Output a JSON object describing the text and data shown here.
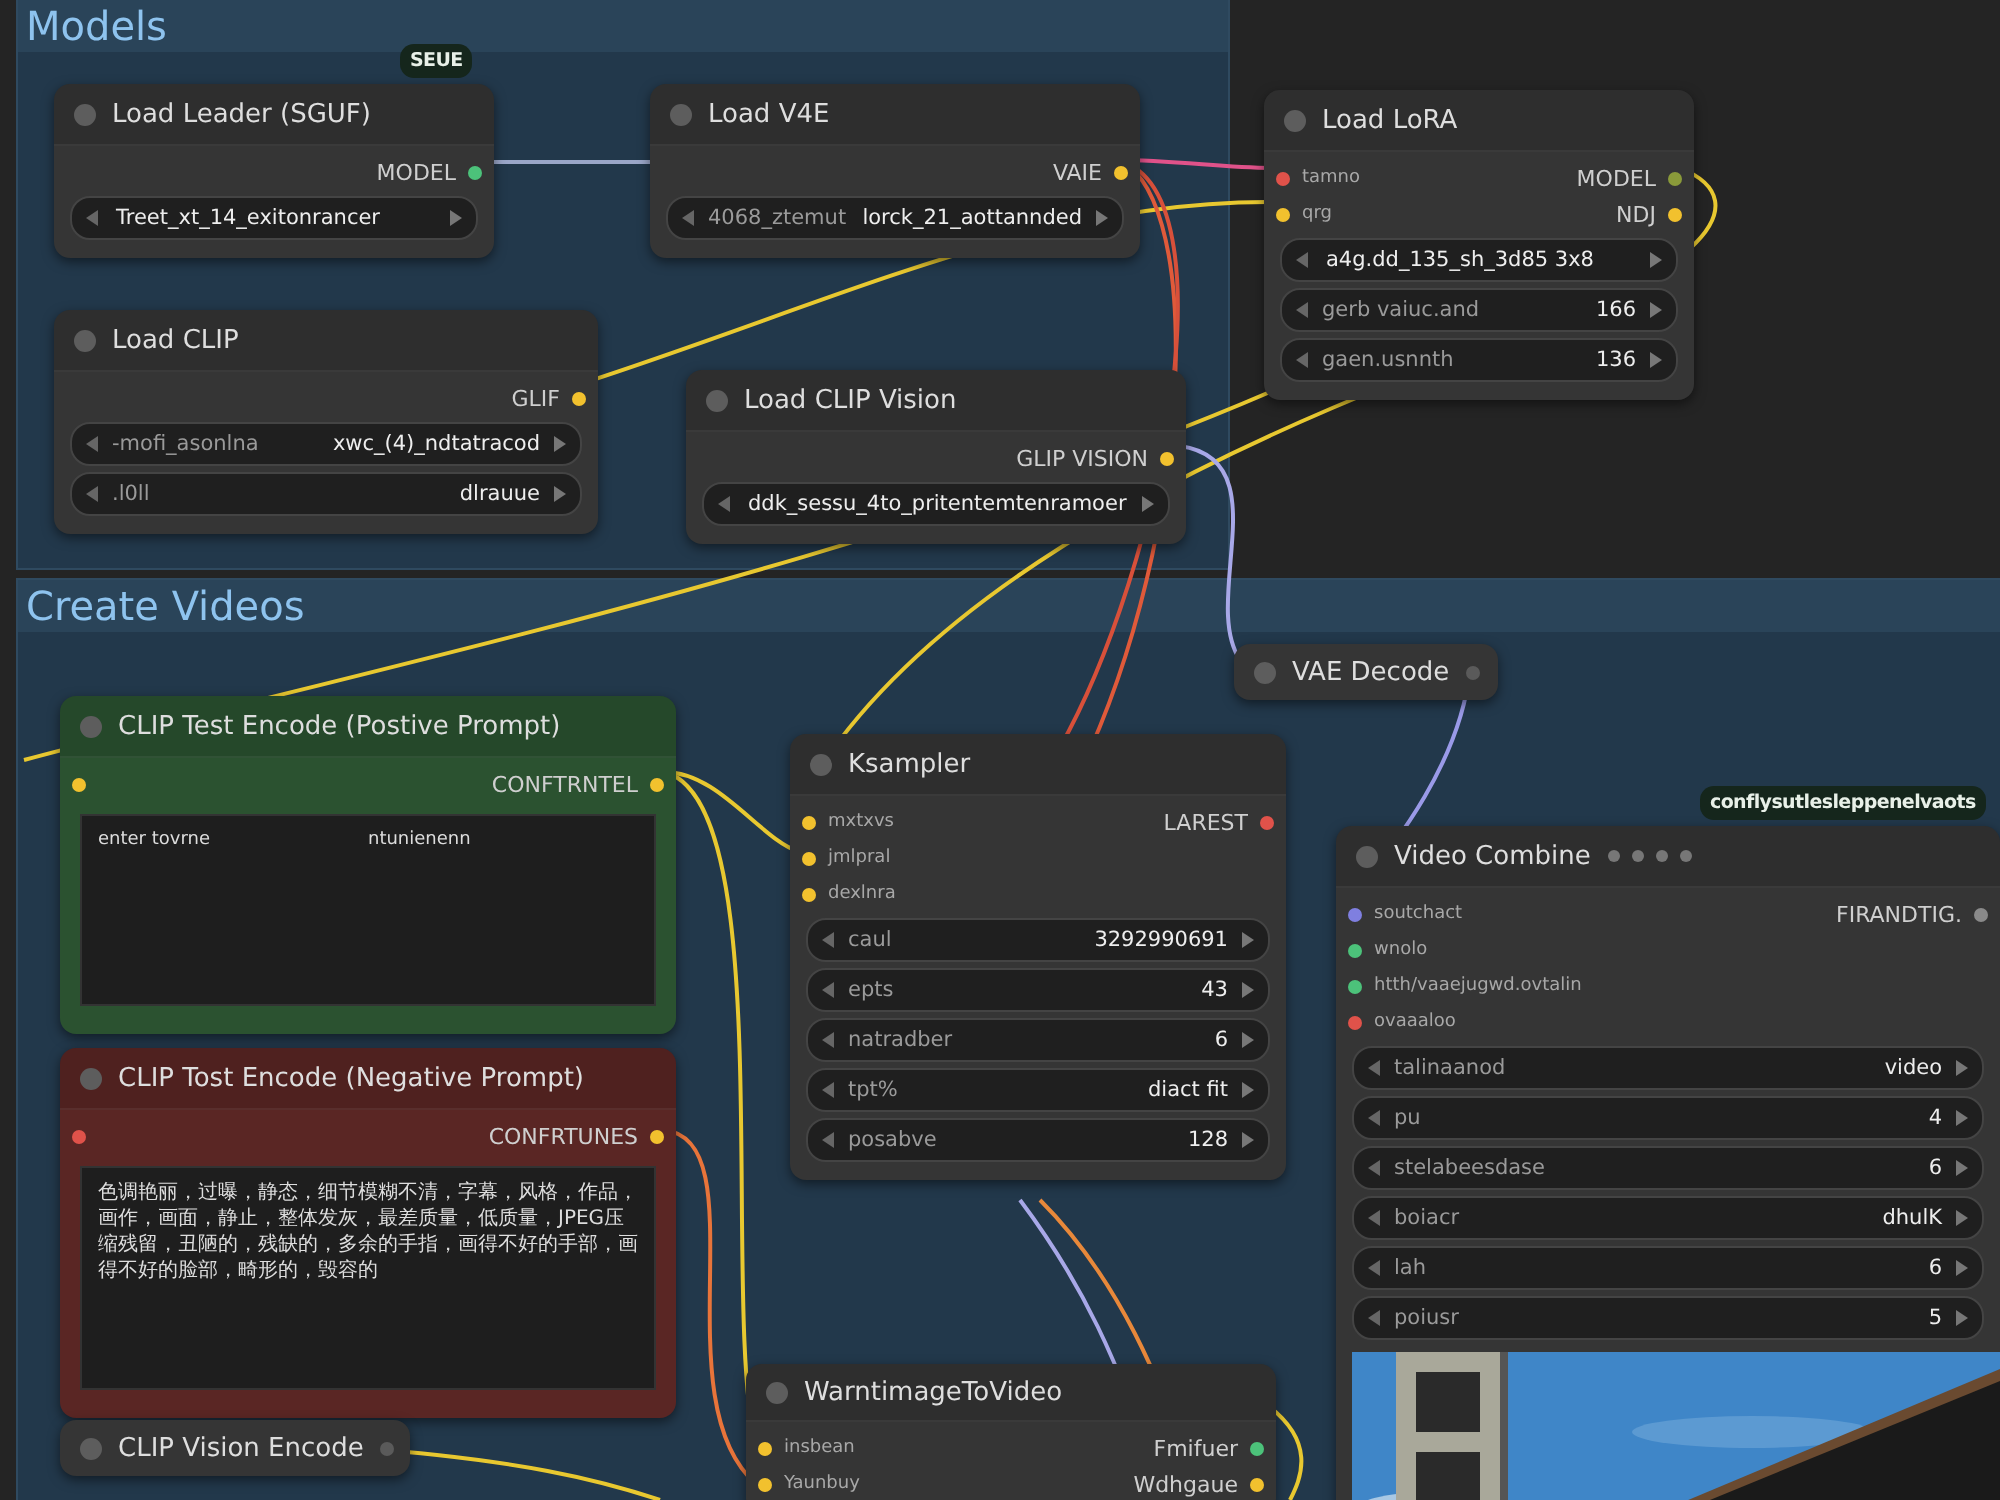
{
  "groups": [
    {
      "title": "Models"
    },
    {
      "title": "Create Videos"
    }
  ],
  "badges": [
    {
      "text": "SEUE"
    },
    {
      "text": "conflysutlesleppenelvaots"
    }
  ],
  "nodes": [
    {
      "kind": "full",
      "title": "Load Leader (SGUF)",
      "color": "#353535",
      "outputs": [
        {
          "label": "MODEL",
          "color": "#4cc27a"
        }
      ],
      "widgets": [
        {
          "value": "Treet_xt_14_exitonrancer"
        }
      ]
    },
    {
      "kind": "full",
      "title": "Load V4E",
      "color": "#353535",
      "outputs": [
        {
          "label": "VAIE",
          "color": "#f2c12e"
        }
      ],
      "widgets": [
        {
          "label": "4068_ztemut",
          "value": "lorck_21_aottannded"
        }
      ]
    },
    {
      "kind": "full",
      "title": "Load LoRA",
      "color": "#353535",
      "inputs": [
        {
          "label": "tamno",
          "color": "#e0524a"
        },
        {
          "label": "qrg",
          "color": "#f2c12e"
        }
      ],
      "outputs": [
        {
          "label": "MODEL",
          "color": "#8a9a3a"
        },
        {
          "label": "NDJ",
          "color": "#f2c12e"
        }
      ],
      "widgets": [
        {
          "value": "a4g.dd_135_sh_3d85 3x8"
        },
        {
          "label": "gerb vaiuc.and",
          "value": "166"
        },
        {
          "label": "gaen.usnnth",
          "value": "136"
        }
      ]
    },
    {
      "kind": "full",
      "title": "Load CLIP",
      "color": "#353535",
      "outputs": [
        {
          "label": "GLIF",
          "color": "#f2c12e"
        }
      ],
      "widgets": [
        {
          "label": "-mofi_asonlna",
          "value": "xwc_(4)_ndtatracod"
        },
        {
          "label": ".l0ll",
          "value": "dlrauue"
        }
      ]
    },
    {
      "kind": "full",
      "title": "Load CLIP Vision",
      "color": "#353535",
      "outputs": [
        {
          "label": "GLIP VISION",
          "color": "#f2c12e"
        }
      ],
      "widgets": [
        {
          "value": "ddk_sessu_4to_pritentemtenramoer"
        }
      ]
    },
    {
      "kind": "full",
      "title": "CLIP Test Encode (Postive Prompt)",
      "color": "#2b5230",
      "inputs": [
        {
          "color": "#f2c12e"
        }
      ],
      "outputs": [
        {
          "label": "CONFTRNTEL",
          "color": "#f2c12e"
        }
      ],
      "prompt": [
        "enter tovrne",
        "ntunienenn"
      ]
    },
    {
      "kind": "full",
      "title": "CLIP Tost Encode (Negative Prompt)",
      "color": "#5a2624",
      "inputs": [
        {
          "color": "#e0524a"
        }
      ],
      "outputs": [
        {
          "label": "CONFRTUNES",
          "color": "#f2c12e"
        }
      ],
      "prompt": [
        "色调艳丽，过曝，静态，细节模糊不清，字幕，风格，作品，画作，画面，静止，整体发灰，最差质量，低质量，JPEG压缩残留，丑陋的，残缺的，多余的手指，画得不好的手部，画得不好的脸部，畸形的，毁容的"
      ]
    },
    {
      "kind": "collapsed",
      "title": "CLIP Vision Encode",
      "color": "#353535",
      "outputs": [
        {
          "color": "#5a5a5a"
        }
      ]
    },
    {
      "kind": "collapsed",
      "title": "VAE Decode",
      "color": "#353535",
      "outputs": [
        {
          "color": "#5a5a5a"
        }
      ]
    },
    {
      "kind": "full",
      "title": "Ksampler",
      "color": "#353535",
      "inputs": [
        {
          "label": "mxtxvs",
          "color": "#f2c12e"
        },
        {
          "label": "jmlpral",
          "color": "#f2c12e"
        },
        {
          "label": "dexlnra",
          "color": "#f2c12e"
        }
      ],
      "outputs": [
        {
          "label": "LAREST",
          "color": "#e0524a"
        }
      ],
      "widgets": [
        {
          "label": "caul",
          "value": "3292990691"
        },
        {
          "label": "epts",
          "value": "43"
        },
        {
          "label": "natradber",
          "value": "6"
        },
        {
          "label": "tpt%",
          "value": "diact fit"
        },
        {
          "label": "posabve",
          "value": "128"
        }
      ]
    },
    {
      "kind": "full",
      "title": "Video Combine",
      "color": "#353535",
      "inputs": [
        {
          "label": "soutchact",
          "color": "#7f7fe0"
        },
        {
          "label": "wnolo",
          "color": "#4cc27a"
        },
        {
          "label": "htth/vaaejugwd.ovtalin",
          "color": "#4cc27a"
        },
        {
          "label": "ovaaaloo",
          "color": "#e0524a"
        }
      ],
      "outputs": [
        {
          "label": "FIRANDTIG.",
          "color": "#8a8a8a"
        }
      ],
      "widgets": [
        {
          "label": "talinaanod",
          "value": "video"
        },
        {
          "label": "pu",
          "value": "4"
        },
        {
          "label": "stelabeesdase",
          "value": "6"
        },
        {
          "label": "boiacr",
          "value": "dhulK"
        },
        {
          "label": "lah",
          "value": "6"
        },
        {
          "label": "poiusr",
          "value": "5"
        }
      ],
      "preview": {
        "kind": "picture"
      }
    },
    {
      "kind": "full",
      "title": "WarntimageToVideo",
      "color": "#353535",
      "inputs": [
        {
          "label": "insbean",
          "color": "#f2c12e"
        },
        {
          "label": "Yaunbuy",
          "color": "#f2c12e"
        }
      ],
      "outputs": [
        {
          "label": "Fmifuer",
          "color": "#4cc27a"
        },
        {
          "label": "Wdhgaue",
          "color": "#f2c12e"
        }
      ]
    }
  ]
}
